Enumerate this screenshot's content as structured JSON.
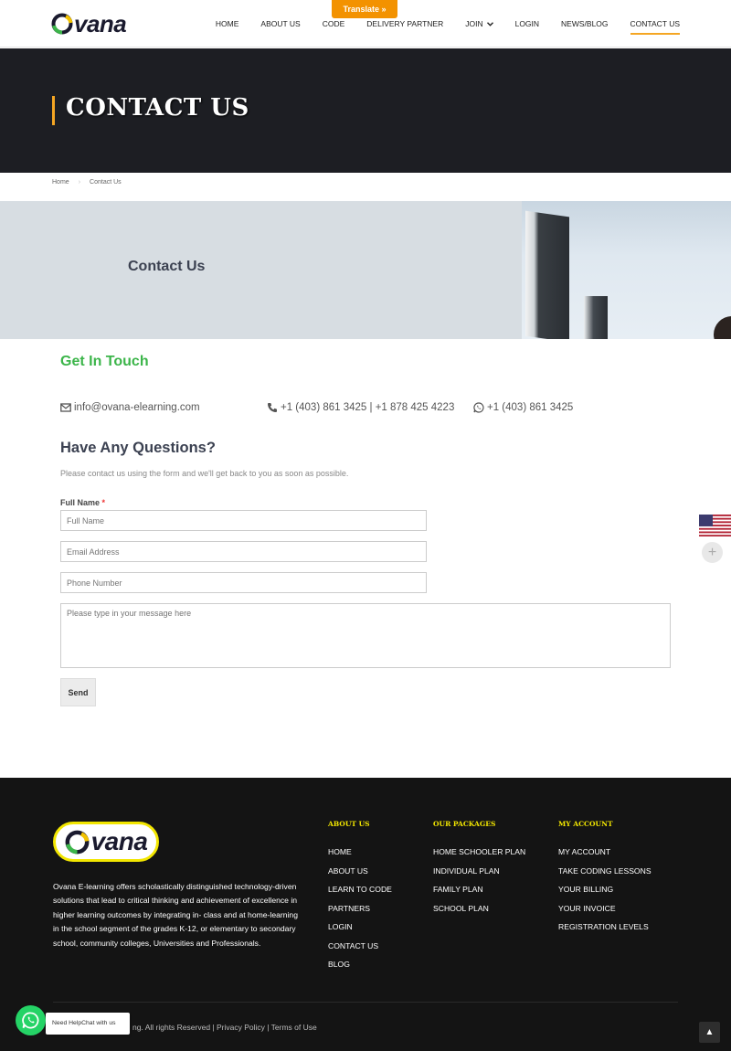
{
  "header": {
    "logo_text": "vana",
    "translate_label": "Translate »",
    "nav": [
      {
        "label": "HOME"
      },
      {
        "label": "ABOUT US"
      },
      {
        "label": "CODE"
      },
      {
        "label": "DELIVERY PARTNER"
      },
      {
        "label": "JOIN"
      },
      {
        "label": "LOGIN"
      },
      {
        "label": "NEWS/BLOG"
      },
      {
        "label": "CONTACT US"
      }
    ]
  },
  "page": {
    "title": "CONTACT US",
    "breadcrumb": {
      "home": "Home",
      "current": "Contact Us"
    },
    "banner_title": "Contact Us"
  },
  "contact": {
    "heading": "Get In Touch",
    "email": "info@ovana-elearning.com",
    "phone": "+1 (403) 861 3425 | +1 878 425 4223",
    "whatsapp": "+1 (403) 861 3425",
    "questions_heading": "Have Any Questions?",
    "questions_sub": "Please contact us using the form and we'll get back to you as soon as possible."
  },
  "form": {
    "full_name_label": "Full Name",
    "required_mark": "*",
    "full_name_placeholder": "Full Name",
    "email_placeholder": "Email Address",
    "phone_placeholder": "Phone Number",
    "message_placeholder": "Please type in your message here",
    "send_label": "Send"
  },
  "footer": {
    "logo_text": "vana",
    "description": "Ovana E-learning offers scholastically distinguished technology-driven solutions that lead to critical thinking and achievement of excellence in higher learning outcomes by integrating in- class and at home-learning in the school segment of the grades K-12, or elementary to secondary school, community colleges, Universities and Professionals.",
    "columns": [
      {
        "title": "ABOUT US",
        "items": [
          "HOME",
          "ABOUT US",
          "LEARN TO CODE",
          "PARTNERS",
          "LOGIN",
          "CONTACT US",
          "BLOG"
        ]
      },
      {
        "title": "OUR PACKAGES",
        "items": [
          "HOME SCHOOLER PLAN",
          "INDIVIDUAL PLAN",
          "FAMILY PLAN",
          "SCHOOL PLAN"
        ]
      },
      {
        "title": "MY ACCOUNT",
        "items": [
          "MY ACCOUNT",
          "TAKE CODING LESSONS",
          "YOUR BILLING",
          "YOUR INVOICE",
          "REGISTRATION LEVELS"
        ]
      }
    ],
    "copyright": "ng. All rights Reserved | Privacy Policy | Terms of Use"
  },
  "widgets": {
    "helpchat_label": "Need HelpChat with us",
    "scroll_top_glyph": "▲",
    "plus_glyph": "+"
  },
  "colors": {
    "accent_orange": "#f5a623",
    "translate_orange": "#f39200",
    "green_heading": "#3cb54a",
    "footer_yellow": "#f2e600",
    "dark_band": "#1d1e23",
    "footer_bg": "#141414"
  }
}
